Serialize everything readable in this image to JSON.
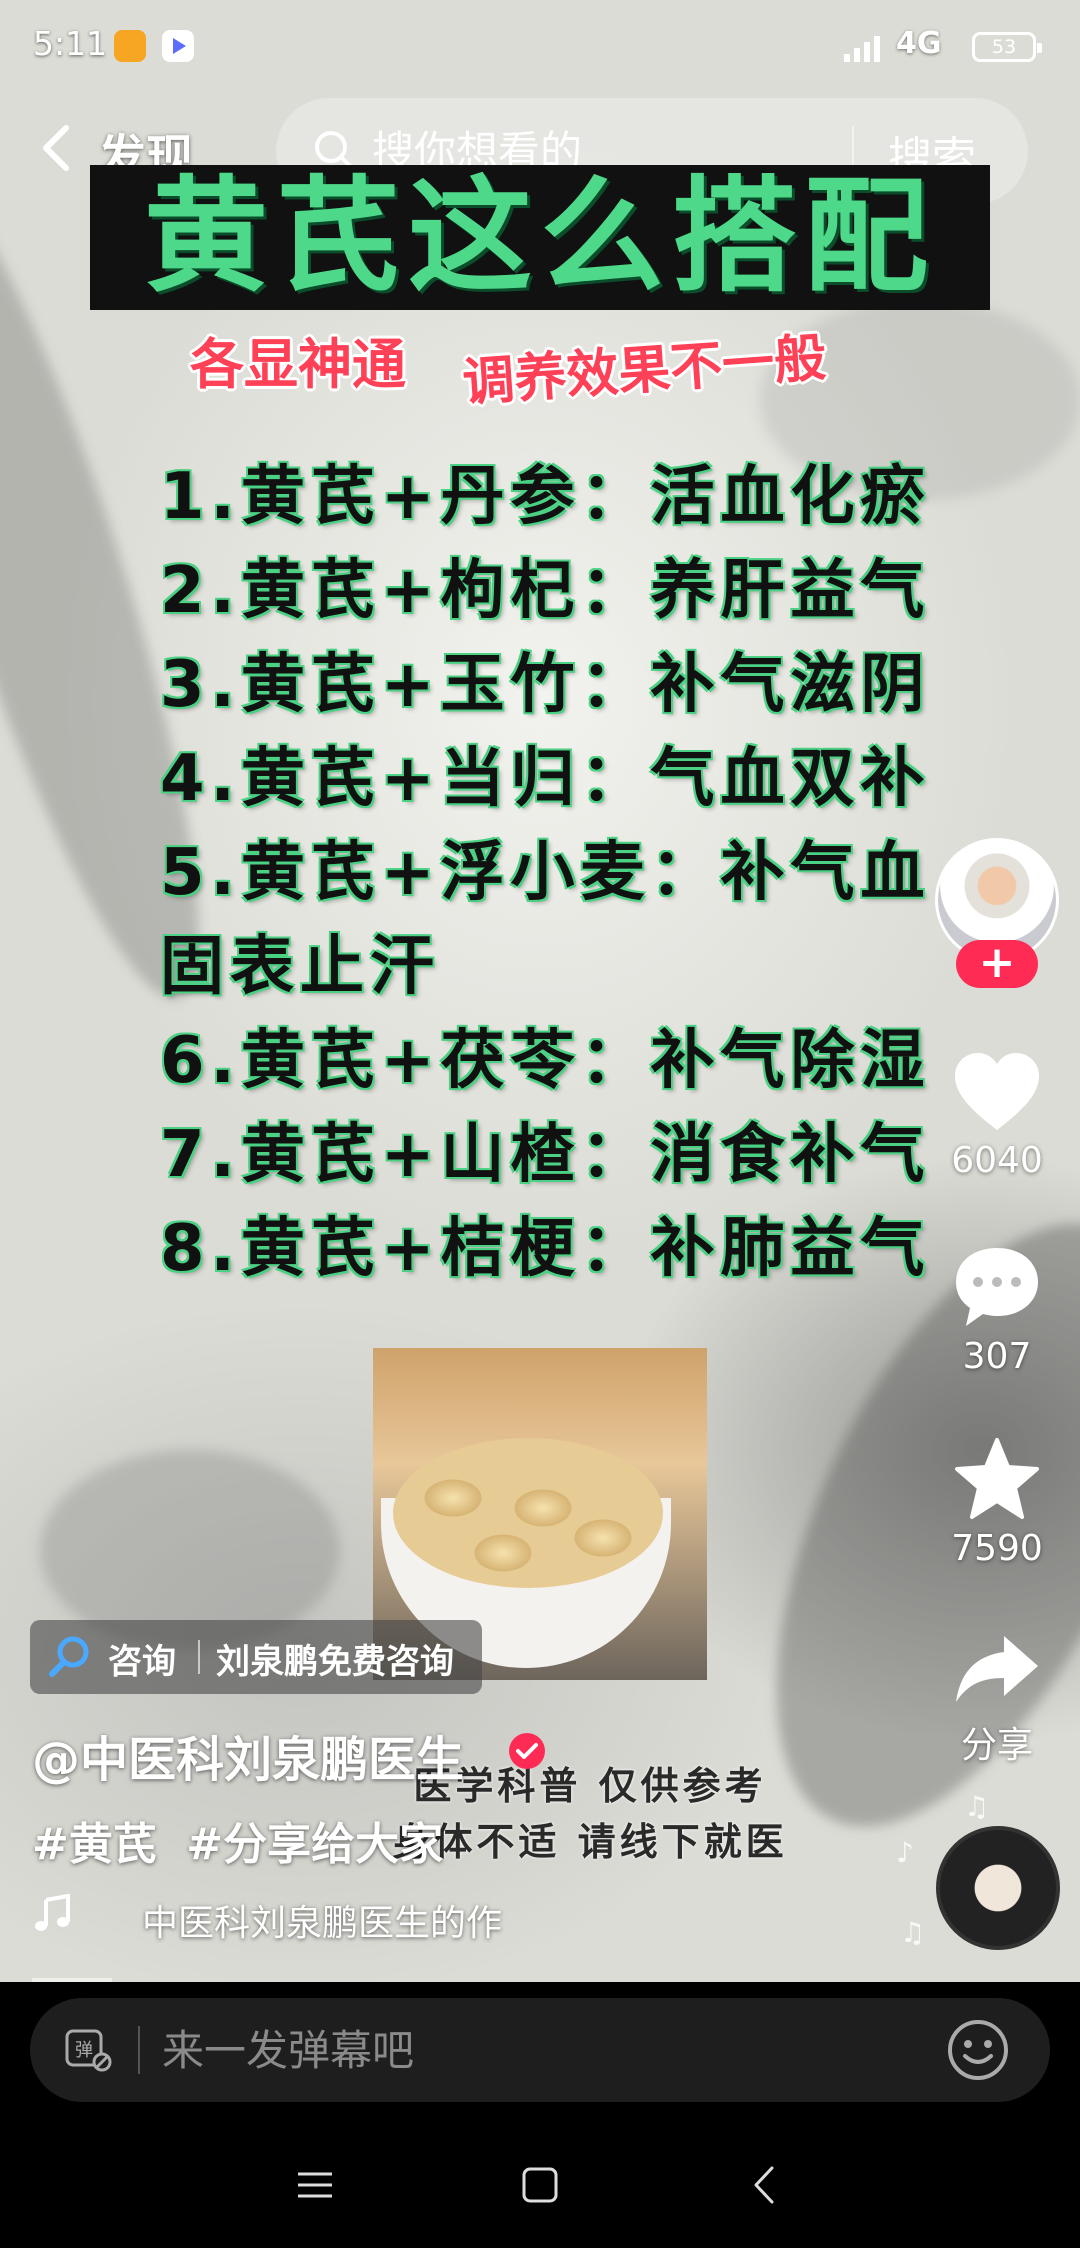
{
  "status_bar": {
    "time": "5:11",
    "network": "4G",
    "battery": "53"
  },
  "header": {
    "back_label": "发现",
    "search_placeholder": "搜你想看的",
    "search_button": "搜索"
  },
  "video": {
    "title": "黄芪这么搭配",
    "subtitle_part1": "各显神通",
    "subtitle_part2": "调养效果不一般",
    "combinations": [
      "1.黄芪+丹参：活血化瘀",
      "2.黄芪+枸杞：养肝益气",
      "3.黄芪+玉竹：补气滋阴",
      "4.黄芪+当归：气血双补",
      "5.黄芪+浮小麦：补气血",
      "固表止汗",
      "6.黄芪+茯苓：补气除湿",
      "7.黄芪+山楂：消食补气",
      "8.黄芪+桔梗：补肺益气"
    ],
    "disclaimer_line1": "医学科普  仅供参考",
    "disclaimer_line2": "身体不适  请线下就医"
  },
  "actions": {
    "follow": "+",
    "likes": "6040",
    "comments": "307",
    "favorites": "7590",
    "share": "分享"
  },
  "consult": {
    "label": "咨询",
    "name": "刘泉鹏免费咨询"
  },
  "author": {
    "name": "@中医科刘泉鹏医生"
  },
  "hashtags": [
    "#黄芪",
    "#分享给大家"
  ],
  "music": {
    "text": "中医科刘泉鹏医生的作"
  },
  "comment_bar": {
    "placeholder": "来一发弹幕吧"
  },
  "colors": {
    "accent": "#fe2c55",
    "title_green": "#4ed98a",
    "subtitle_red": "#ff4157"
  },
  "icons": [
    "back-arrow-icon",
    "search-icon",
    "heart-icon",
    "comment-icon",
    "star-icon",
    "share-icon",
    "music-note-icon",
    "danmaku-icon",
    "emoji-icon",
    "verified-icon"
  ]
}
